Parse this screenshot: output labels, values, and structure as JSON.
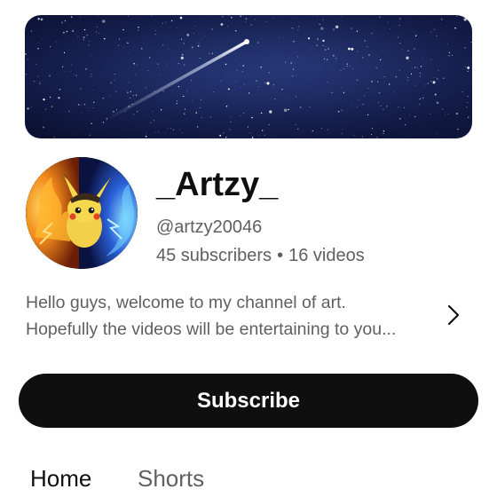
{
  "channel": {
    "name": "_Artzy_",
    "handle": "@artzy20046",
    "subscribers": "45 subscribers",
    "separator": "•",
    "videos": "16 videos",
    "description_line1": "Hello guys, welcome to my channel of art.",
    "description_line2": "Hopefully the videos will be entertaining to you..."
  },
  "actions": {
    "subscribe_label": "Subscribe"
  },
  "tabs": [
    {
      "label": "Home",
      "selected": true
    },
    {
      "label": "Shorts",
      "selected": false
    }
  ],
  "icons": {
    "banner": "starry-night-shooting-star",
    "avatar": "pikachu-fire-ice-avatar",
    "description_expand": "chevron-right-icon"
  },
  "colors": {
    "primary_text": "#0f0f0f",
    "secondary_text": "#5f5f5f",
    "subscribe_bg": "#0f0f0f",
    "subscribe_text": "#ffffff",
    "banner_bg": "#121a44"
  }
}
